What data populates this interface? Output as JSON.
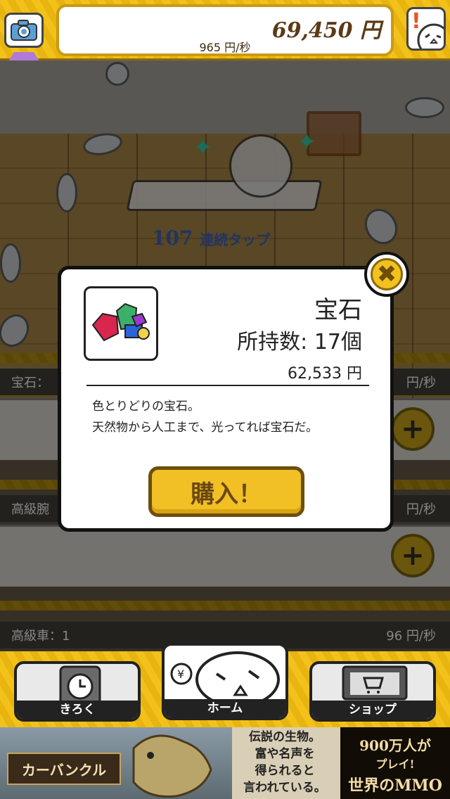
{
  "header": {
    "money": "69,450 円",
    "rate": "965 円/秒",
    "alert_symbol": "!"
  },
  "scene": {
    "tap_count": "107",
    "tap_label": "連続タップ"
  },
  "shelves": [
    {
      "label": "宝石：",
      "rate": "円/秒"
    },
    {
      "label": "高級腕",
      "rate": "円/秒"
    },
    {
      "label": "高級車：1",
      "rate": "96 円/秒"
    }
  ],
  "modal": {
    "item_name": "宝石",
    "owned": "所持数: 17個",
    "price": "62,533 円",
    "description_line1": "色とりどりの宝石。",
    "description_line2": "天然物から人工まで、光ってれば宝石だ。",
    "buy_label": "購入！",
    "close_symbol": "✖"
  },
  "nav": {
    "tabs": [
      {
        "label": "きろく",
        "icon": "clock-phone-icon"
      },
      {
        "label": "ホーム",
        "icon": "home-character-icon"
      },
      {
        "label": "ショップ",
        "icon": "shop-laptop-icon"
      }
    ]
  },
  "ad": {
    "title": "カーバンクル",
    "middle_line1": "伝説の生物。",
    "middle_line2": "富や名声を",
    "middle_line3": "得られると",
    "middle_line4": "言われている。",
    "right_line1": "900万人が",
    "right_line2": "プレイ!",
    "right_line3": "世界のMMO"
  },
  "colors": {
    "accent_gold": "#f3c21a",
    "text_dark": "#222222",
    "tap_blue": "#3b5aa8"
  }
}
